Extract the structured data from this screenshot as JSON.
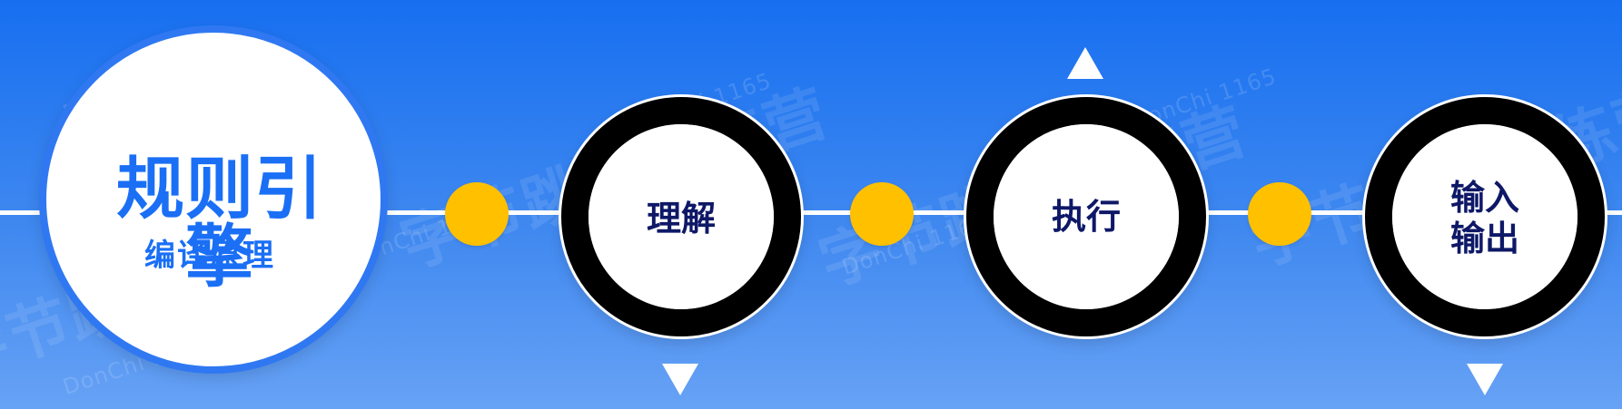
{
  "title": "规则引擎",
  "subtitle": "编译原理",
  "steps": [
    {
      "label": "理解"
    },
    {
      "label": "执行"
    },
    {
      "label": "输入\n输出"
    }
  ],
  "watermarks": {
    "big": "字节跳动训练营",
    "small": "DonChi 1165"
  },
  "colors": {
    "background_top": "#176ff0",
    "background_bottom": "#67a2f5",
    "accent_blue": "#1a6ff5",
    "dot_yellow": "#ffc000",
    "ring_black": "#000000",
    "text_navy": "#0e1867",
    "line_white": "#ffffff"
  }
}
